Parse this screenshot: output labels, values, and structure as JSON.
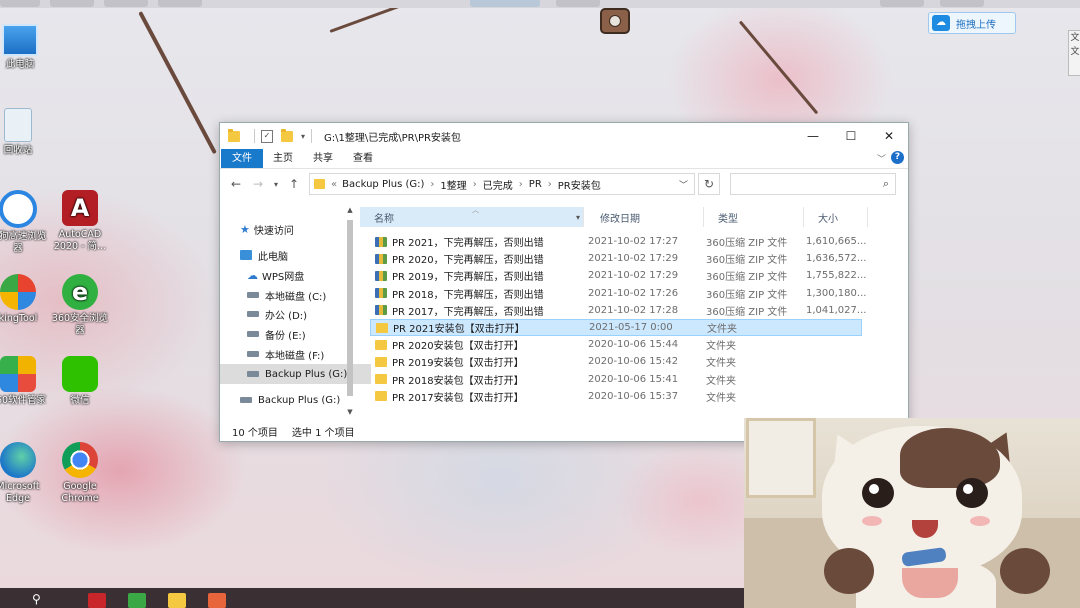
{
  "colors": {
    "accent": "#1979ca",
    "selection": "#cce8ff",
    "folder": "#f5c842",
    "taskbar": "#3a2f33"
  },
  "top_bar": {
    "upload_button": {
      "label": "拖拽上传",
      "icon": "cloud-icon"
    },
    "side_tab": "文\n文"
  },
  "desktop_icons": [
    {
      "label": "此电脑",
      "icon": "computer-icon"
    },
    {
      "label": "回收站",
      "icon": "recycle-bin-icon"
    },
    {
      "label": "搜狗高速浏览器",
      "icon": "sogou-browser-icon"
    },
    {
      "label": "AutoCAD 2020 - 简...",
      "icon": "autocad-icon"
    },
    {
      "label": "kingTool",
      "icon": "kingtool-icon"
    },
    {
      "label": "360安全浏览器",
      "icon": "360-browser-icon"
    },
    {
      "label": "360软件管家",
      "icon": "360-software-icon"
    },
    {
      "label": "微信",
      "icon": "wechat-icon"
    },
    {
      "label": "Microsoft Edge",
      "icon": "edge-icon"
    },
    {
      "label": "Google Chrome",
      "icon": "chrome-icon"
    }
  ],
  "explorer": {
    "title": "G:\\1整理\\已完成\\PR\\PR安装包",
    "window_controls": [
      "—",
      "☐",
      "✕"
    ],
    "ribbon": {
      "tabs": [
        "文件",
        "主页",
        "共享",
        "查看"
      ],
      "help": "?"
    },
    "address": {
      "prefix": "«",
      "crumbs": [
        "Backup Plus (G:)",
        "1整理",
        "已完成",
        "PR",
        "PR安装包"
      ]
    },
    "search": {
      "placeholder": ""
    },
    "nav_pane": [
      {
        "label": "快速访问",
        "icon": "star-icon",
        "color": "#2e7bd0",
        "selected": false
      },
      {
        "label": "此电脑",
        "icon": "computer-icon",
        "color": "#3a8fd9",
        "selected": false
      },
      {
        "label": "WPS网盘",
        "icon": "cloud-icon",
        "color": "#2e7bd0",
        "selected": false
      },
      {
        "label": "本地磁盘 (C:)",
        "icon": "drive-icon",
        "color": "#7b8a99",
        "selected": false
      },
      {
        "label": "办公 (D:)",
        "icon": "drive-icon",
        "color": "#7b8a99",
        "selected": false
      },
      {
        "label": "备份 (E:)",
        "icon": "drive-icon",
        "color": "#7b8a99",
        "selected": false
      },
      {
        "label": "本地磁盘 (F:)",
        "icon": "drive-icon",
        "color": "#7b8a99",
        "selected": false
      },
      {
        "label": "Backup Plus (G:)",
        "icon": "drive-icon",
        "color": "#7b8a99",
        "selected": true
      },
      {
        "label": "Backup Plus (G:)",
        "icon": "drive-icon",
        "color": "#7b8a99",
        "selected": false
      }
    ],
    "columns": [
      "名称",
      "修改日期",
      "类型",
      "大小"
    ],
    "files": [
      {
        "name": "PR 2021，下完再解压，否则出错",
        "date": "2021-10-02 17:27",
        "type": "360压缩 ZIP 文件",
        "size": "1,610,665...",
        "kind": "zip",
        "selected": false
      },
      {
        "name": "PR 2020，下完再解压，否则出错",
        "date": "2021-10-02 17:29",
        "type": "360压缩 ZIP 文件",
        "size": "1,636,572...",
        "kind": "zip",
        "selected": false
      },
      {
        "name": "PR 2019，下完再解压，否则出错",
        "date": "2021-10-02 17:29",
        "type": "360压缩 ZIP 文件",
        "size": "1,755,822...",
        "kind": "zip",
        "selected": false
      },
      {
        "name": "PR 2018，下完再解压，否则出错",
        "date": "2021-10-02 17:26",
        "type": "360压缩 ZIP 文件",
        "size": "1,300,180...",
        "kind": "zip",
        "selected": false
      },
      {
        "name": "PR 2017，下完再解压，否则出错",
        "date": "2021-10-02 17:28",
        "type": "360压缩 ZIP 文件",
        "size": "1,041,027...",
        "kind": "zip",
        "selected": false
      },
      {
        "name": "PR 2021安装包【双击打开】",
        "date": "2021-05-17 0:00",
        "type": "文件夹",
        "size": "",
        "kind": "folder",
        "selected": true
      },
      {
        "name": "PR 2020安装包【双击打开】",
        "date": "2020-10-06 15:44",
        "type": "文件夹",
        "size": "",
        "kind": "folder",
        "selected": false
      },
      {
        "name": "PR 2019安装包【双击打开】",
        "date": "2020-10-06 15:42",
        "type": "文件夹",
        "size": "",
        "kind": "folder",
        "selected": false
      },
      {
        "name": "PR 2018安装包【双击打开】",
        "date": "2020-10-06 15:41",
        "type": "文件夹",
        "size": "",
        "kind": "folder",
        "selected": false
      },
      {
        "name": "PR 2017安装包【双击打开】",
        "date": "2020-10-06 15:37",
        "type": "文件夹",
        "size": "",
        "kind": "folder",
        "selected": false
      }
    ],
    "status": {
      "count": "10 个项目",
      "selected": "选中 1 个项目"
    }
  },
  "taskbar_icons": [
    "search-icon",
    "wps-icon",
    "green-app-icon",
    "file-explorer-icon",
    "orange-app-icon"
  ]
}
